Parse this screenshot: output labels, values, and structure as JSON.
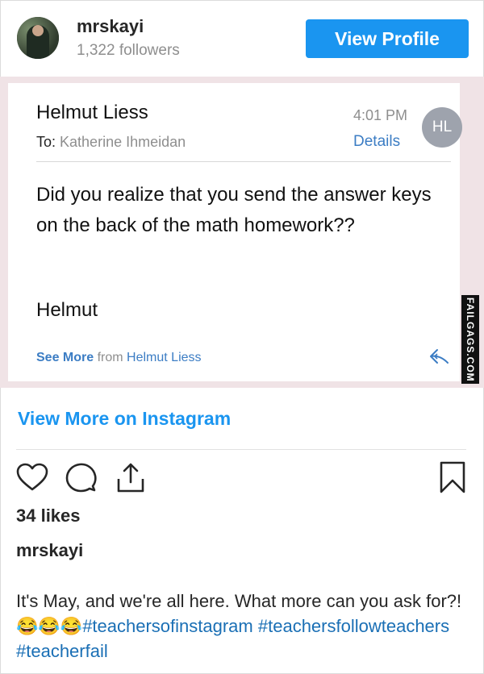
{
  "header": {
    "username": "mrskayi",
    "followers": "1,322 followers",
    "view_profile_label": "View Profile"
  },
  "email": {
    "sender": "Helmut Liess",
    "time": "4:01 PM",
    "details_label": "Details",
    "to_label": "To:",
    "to_value": "Katherine Ihmeidan",
    "avatar_initials": "HL",
    "body": "Did you realize that you send the answer keys on the back of the math homework??",
    "signature": "Helmut",
    "see_more_label": "See More",
    "see_more_from": "from",
    "see_more_name": "Helmut Liess"
  },
  "watermark": "FAILGAGS.COM",
  "post": {
    "view_more_label": "View More on Instagram",
    "likes": "34 likes",
    "caption_user": "mrskayi",
    "caption_text": "It's May, and we're all here. What more can you ask for?! 😂😂😂",
    "hashtags": [
      "#teachersofinstagram",
      "#teachersfollowteachers",
      "#teacherfail"
    ]
  },
  "colors": {
    "accent": "#1a95f0",
    "link": "#3c7dc4",
    "muted": "#8e8e8e"
  }
}
